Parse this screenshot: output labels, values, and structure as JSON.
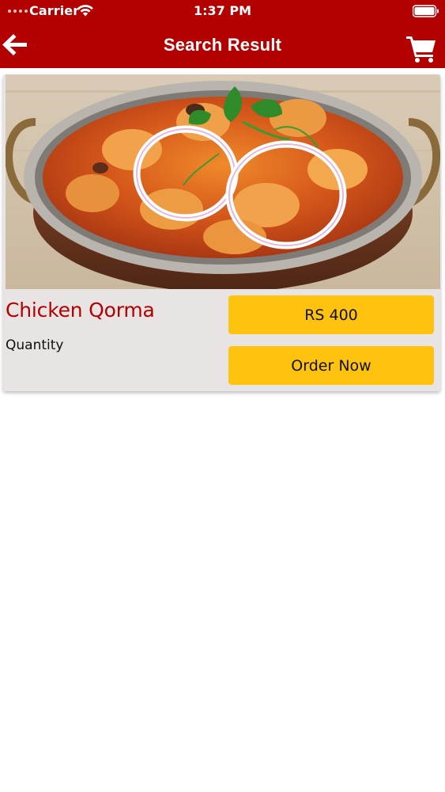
{
  "status_bar": {
    "carrier": "Carrier",
    "time": "1:37 PM",
    "icons": [
      "signal-dots",
      "wifi-icon",
      "battery-icon"
    ]
  },
  "nav": {
    "title": "Search Result",
    "back_icon": "arrow-left-icon",
    "cart_icon": "shopping-cart-icon"
  },
  "colors": {
    "brand_red": "#B30000",
    "accent_yellow": "#FFC20E",
    "card_bg": "#E8E4E4"
  },
  "result": {
    "image": "chicken-qorma-dish-photo",
    "name": "Chicken Qorma",
    "quantity_label": "Quantity",
    "price_label": "RS 400",
    "order_label": "Order Now"
  }
}
